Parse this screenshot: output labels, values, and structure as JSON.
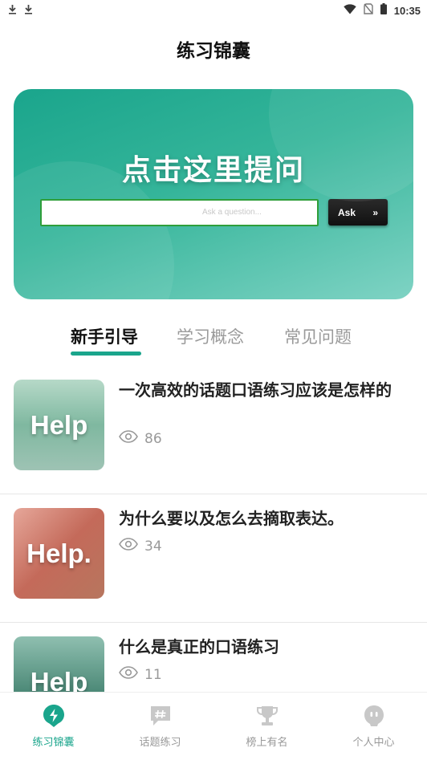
{
  "status_bar": {
    "time": "10:35"
  },
  "header": {
    "title": "练习锦囊"
  },
  "banner": {
    "title": "点击这里提问",
    "input_placeholder": "Ask a question...",
    "button_label": "Ask",
    "button_arrow": "»"
  },
  "tabs": [
    {
      "label": "新手引导",
      "active": true
    },
    {
      "label": "学习概念",
      "active": false
    },
    {
      "label": "常见问题",
      "active": false
    }
  ],
  "articles": [
    {
      "title": "一次高效的话题口语练习应该是怎样的",
      "views": "86",
      "thumb_text": "Help"
    },
    {
      "title": "为什么要以及怎么去摘取表达。",
      "views": "34",
      "thumb_text": "Help."
    },
    {
      "title": "什么是真正的口语练习",
      "views": "11",
      "thumb_text": "Help"
    }
  ],
  "bottom_nav": [
    {
      "label": "练习锦囊",
      "icon": "lightning-icon",
      "active": true
    },
    {
      "label": "话题练习",
      "icon": "hash-chat-icon",
      "active": false
    },
    {
      "label": "榜上有名",
      "icon": "trophy-icon",
      "active": false
    },
    {
      "label": "个人中心",
      "icon": "face-icon",
      "active": false
    }
  ],
  "colors": {
    "accent": "#1aa58c",
    "text_muted": "#999999"
  }
}
